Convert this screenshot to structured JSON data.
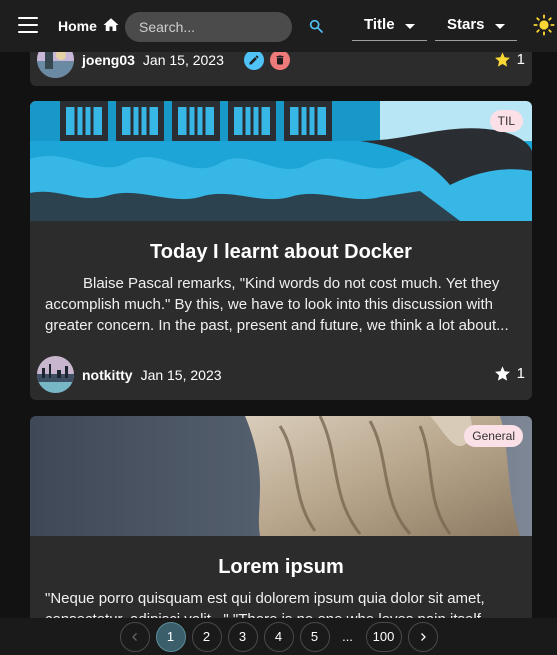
{
  "header": {
    "home_label": "Home",
    "search_placeholder": "Search...",
    "sort_title_label": "Title",
    "sort_stars_label": "Stars"
  },
  "posts": [
    {
      "author": "joeng03",
      "date": "Jan 15, 2023",
      "stars": "1",
      "star_color": "#fdd835"
    },
    {
      "tag": "TIL",
      "title": "Today I learnt about Docker",
      "excerpt": "Blaise Pascal remarks, \"Kind words do not cost much. Yet they accomplish much.\" By this, we have to look into this discussion with greater concern. In the past, present and future, we think a lot about...",
      "author": "notkitty",
      "date": "Jan 15, 2023",
      "stars": "1",
      "star_color": "#ffffff"
    },
    {
      "tag": "General",
      "title": "Lorem ipsum",
      "excerpt": "\"Neque porro quisquam est qui dolorem ipsum quia dolor sit amet, consectetur, adipisci velit...\" \"There is no one who loves pain itself..."
    }
  ],
  "pagination": {
    "pages": [
      "1",
      "2",
      "3",
      "4",
      "5"
    ],
    "ellipsis": "...",
    "last": "100",
    "current": "1"
  },
  "colors": {
    "background": "#121212",
    "card": "#2c2c2c",
    "accent": "#4fc3f7",
    "tag_bg": "#fbe0e7",
    "active_page": "#3a5f6b"
  }
}
